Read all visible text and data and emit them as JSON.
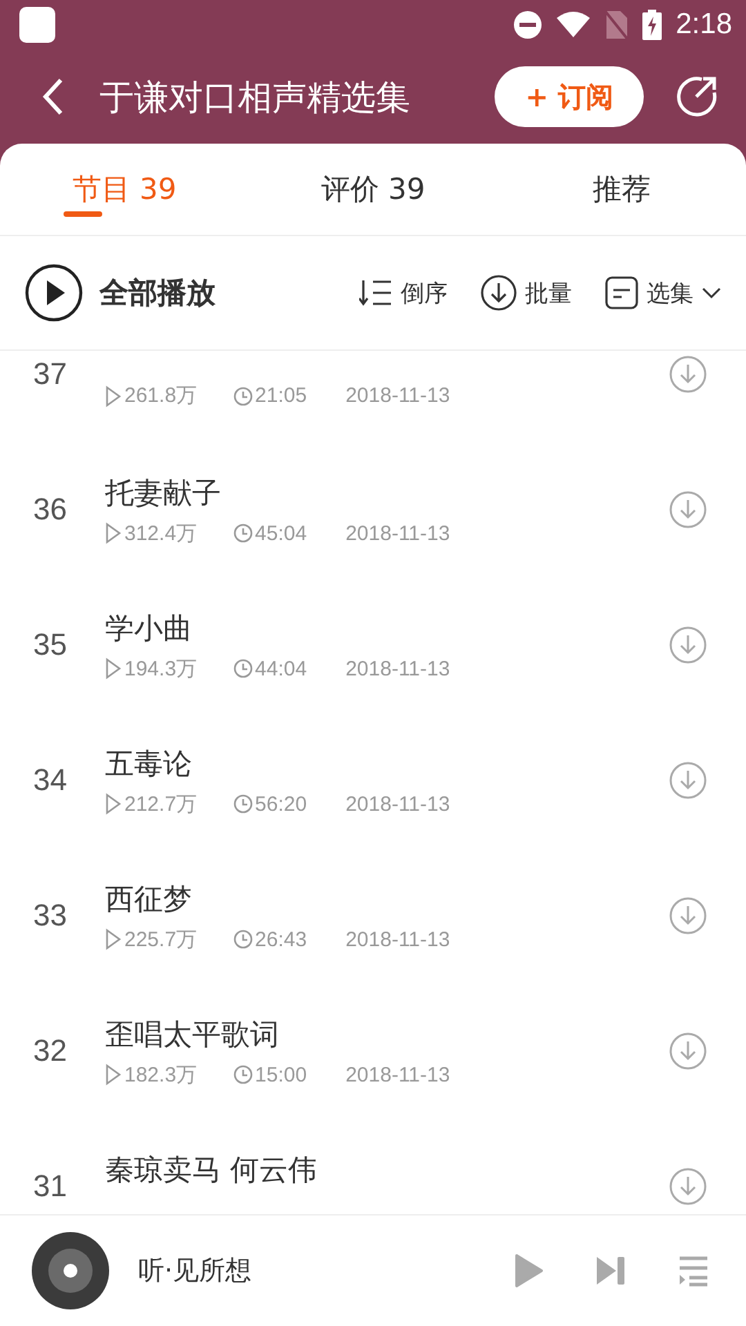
{
  "status_bar": {
    "time": "2:18"
  },
  "header": {
    "title": "于谦对口相声精选集",
    "subscribe": "+ 订阅"
  },
  "tabs": [
    {
      "label": "节目 39",
      "selected": true
    },
    {
      "label": "评价 39",
      "selected": false
    },
    {
      "label": "推荐",
      "selected": false
    }
  ],
  "toolbar": {
    "play_all": "全部播放",
    "sort": "倒序",
    "batch": "批量",
    "select": "选集"
  },
  "episodes": [
    {
      "number": "37",
      "plays": "261.8万",
      "duration": "21:05",
      "date": "2018-11-13"
    },
    {
      "number": "36",
      "title": "托妻献子",
      "plays": "312.4万",
      "duration": "45:04",
      "date": "2018-11-13"
    },
    {
      "number": "35",
      "title": "学小曲",
      "plays": "194.3万",
      "duration": "44:04",
      "date": "2018-11-13"
    },
    {
      "number": "34",
      "title": "五毒论",
      "plays": "212.7万",
      "duration": "56:20",
      "date": "2018-11-13"
    },
    {
      "number": "33",
      "title": "西征梦",
      "plays": "225.7万",
      "duration": "26:43",
      "date": "2018-11-13"
    },
    {
      "number": "32",
      "title": "歪唱太平歌词",
      "plays": "182.3万",
      "duration": "15:00",
      "date": "2018-11-13"
    },
    {
      "number": "31",
      "title": "秦琼卖马 何云伟"
    }
  ],
  "player": {
    "title": "听·见所想"
  }
}
